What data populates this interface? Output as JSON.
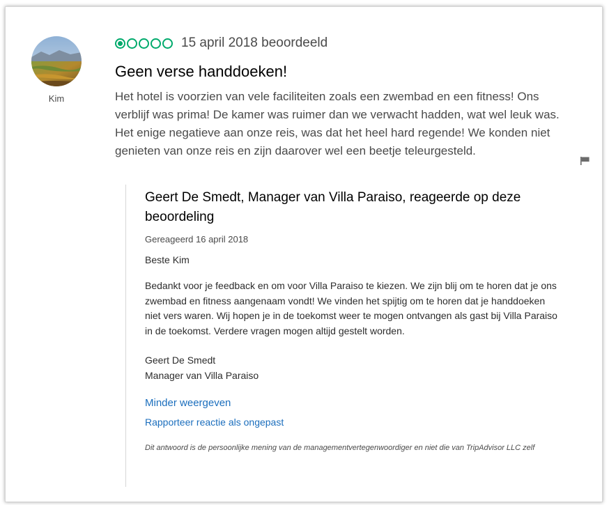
{
  "review": {
    "user_name": "Kim",
    "rating_bubbles": 1,
    "rating_max": 5,
    "date": "15 april 2018 beoordeeld",
    "title": "Geen verse handdoeken!",
    "body": "Het hotel is voorzien van vele faciliteiten zoals een zwembad en een fitness! Ons verblijf was prima! De kamer was ruimer dan we verwacht hadden, wat wel leuk was.  Het enige negatieve aan onze reis, was dat het heel hard regende! We konden niet genieten van onze reis en zijn daarover wel een beetje teleurgesteld."
  },
  "response": {
    "title": "Geert De Smedt, Manager van Villa Paraiso, reageerde op deze beoordeling",
    "date": "Gereageerd 16 april 2018",
    "greeting": "Beste Kim",
    "body": "Bedankt voor je feedback en om voor Villa Paraiso te kiezen. We zijn blij om te horen dat je ons zwembad en fitness aangenaam vondt! We vinden het spijtig om te horen dat je handdoeken niet vers waren. Wij hopen je in de toekomst weer te mogen ontvangen als gast bij Villa Paraiso in de toekomst. Verdere vragen mogen altijd gestelt worden.",
    "signature_name": "Geert De Smedt",
    "signature_role": "Manager van Villa Paraiso",
    "show_less_label": "Minder weergeven",
    "report_label": "Rapporteer reactie als ongepast",
    "disclaimer": "Dit antwoord is de persoonlijke mening van de managementvertegenwoordiger en niet die van TripAdvisor LLC zelf"
  },
  "icons": {
    "rating": "rating-bubble-icon",
    "flag": "flag-icon",
    "avatar": "avatar-landscape-photo"
  },
  "colors": {
    "rating_green": "#00aa6c",
    "link_blue": "#1b6ebd",
    "text_gray": "#4a4a4a"
  }
}
